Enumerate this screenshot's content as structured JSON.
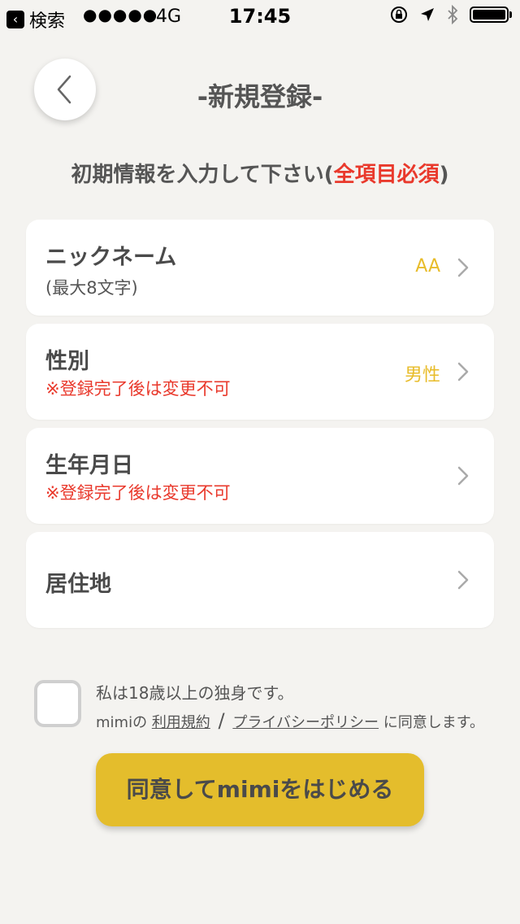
{
  "status_bar": {
    "back_app": "検索",
    "signal": "●●●●●",
    "network": "4G",
    "time": "17:45"
  },
  "header": {
    "title": "-新規登録-"
  },
  "instruction": {
    "text": "初期情報を入力して下さい(",
    "required": "全項目必須",
    "close": ")"
  },
  "fields": [
    {
      "label": "ニックネーム",
      "sub": "(最大8文字)",
      "value": "AA"
    },
    {
      "label": "性別",
      "sub": "※登録完了後は変更不可",
      "value": "男性"
    },
    {
      "label": "生年月日",
      "sub": "※登録完了後は変更不可",
      "value": ""
    },
    {
      "label": "居住地",
      "sub": "",
      "value": ""
    }
  ],
  "agreement": {
    "line1": "私は18歳以上の独身です。",
    "prefix": "mimiの",
    "terms_link": "利用規約",
    "separator": "/",
    "privacy_link": "プライバシーポリシー",
    "suffix": "に同意します。"
  },
  "start_button": {
    "label": "同意してmimiをはじめる"
  },
  "colors": {
    "accent": "#e4bd2c",
    "value_text": "#e8bc2a",
    "warning": "#e9392c",
    "background": "#f4f3f0"
  }
}
